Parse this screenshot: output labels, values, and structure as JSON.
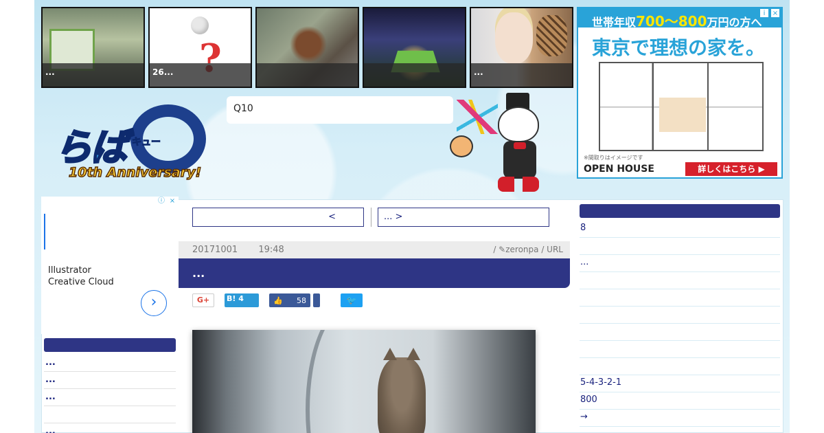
{
  "thumbnails": [
    {
      "caption": "...",
      "subject": "train"
    },
    {
      "caption": "26...",
      "subject": "question-figure"
    },
    {
      "caption": "",
      "subject": "crab"
    },
    {
      "caption": "",
      "subject": "stadium"
    },
    {
      "caption": "...",
      "subject": "woman-cat"
    }
  ],
  "ad_top": {
    "band_prefix": "世帯年収",
    "band_highlight": "700～800",
    "band_suffix": "万円の方へ",
    "headline": "東京で理想の家を。",
    "note": "※間取りはイメージです",
    "brand": "OPEN HOUSE",
    "cta": "詳しくはこちら ▶",
    "info_icon": "i",
    "close_icon": "×"
  },
  "logo": {
    "main": "らば",
    "kyu": "キュー",
    "anniversary": "10th Anniversary!"
  },
  "search": {
    "value": "Q10"
  },
  "ad_left": {
    "line1": "Illustrator",
    "line2": "Creative Cloud",
    "arrow": "›",
    "info_icon": "ⓘ",
    "close_icon": "×"
  },
  "left_list": {
    "items": [
      "...",
      "...",
      "...",
      "",
      "..."
    ]
  },
  "pager": {
    "prev": "<",
    "next": "... >"
  },
  "article": {
    "date": "20171001",
    "time": "19:48",
    "author_meta": "/ ✎zeronpa / URL",
    "title": "..."
  },
  "share": {
    "gplus": "G+",
    "hatena": "B! 4",
    "fb_count": "58",
    "fb_icon": "👍",
    "tw_icon": "🐦"
  },
  "right_list": {
    "items": [
      "8",
      "",
      "...",
      "",
      "",
      "",
      "",
      "",
      "",
      "5-4-3-2-1",
      "800",
      "→"
    ]
  },
  "colors": {
    "nav": "#2e3585",
    "accent": "#29a3d8"
  }
}
